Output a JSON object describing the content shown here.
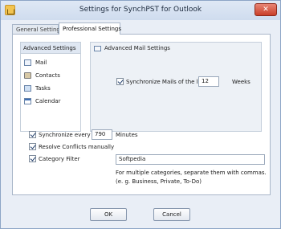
{
  "window": {
    "title": "Settings for SynchPST for Outlook",
    "close_glyph": "✕"
  },
  "tabs": [
    {
      "label": "General Settings"
    },
    {
      "label": "Professional Settings"
    }
  ],
  "sidebar": {
    "header": "Advanced Settings",
    "items": [
      {
        "label": "Mail",
        "icon": "mail-icon"
      },
      {
        "label": "Contacts",
        "icon": "contacts-icon"
      },
      {
        "label": "Tasks",
        "icon": "tasks-icon"
      },
      {
        "label": "Calendar",
        "icon": "calendar-icon"
      }
    ]
  },
  "advanced_mail": {
    "header": "Advanced Mail Settings",
    "sync_label": "Synchronize Mails of the last",
    "sync_checked": true,
    "sync_value": "12",
    "sync_unit": "Weeks"
  },
  "options": {
    "sync_every_label": "Synchronize every",
    "sync_every_checked": true,
    "sync_every_value": "790",
    "sync_every_unit": "Minutes",
    "resolve_label": "Resolve Conflicts manually",
    "resolve_checked": true,
    "category_label": "Category Filter",
    "category_checked": true,
    "category_value": "Softpedia",
    "category_help_1": "For multiple categories, separate them with commas.",
    "category_help_2": "(e. g. Business, Private, To-Do)"
  },
  "buttons": {
    "ok": "OK",
    "cancel": "Cancel"
  }
}
